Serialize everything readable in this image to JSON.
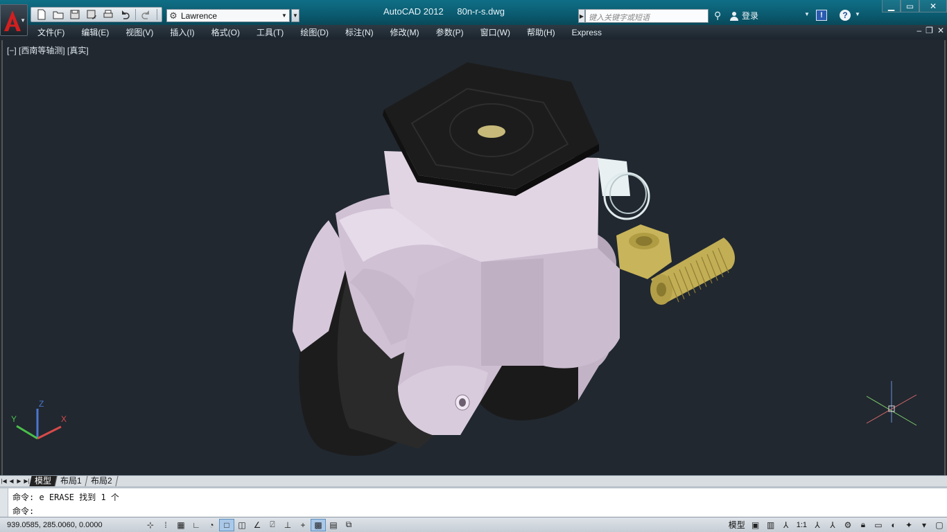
{
  "title": {
    "app": "AutoCAD 2012",
    "file": "80n-r-s.dwg"
  },
  "qat": {
    "workspace": "Lawrence"
  },
  "search": {
    "placeholder": "键入关键字或短语"
  },
  "user": {
    "login_label": "登录"
  },
  "menu": [
    "文件(F)",
    "编辑(E)",
    "视图(V)",
    "插入(I)",
    "格式(O)",
    "工具(T)",
    "绘图(D)",
    "标注(N)",
    "修改(M)",
    "参数(P)",
    "窗口(W)",
    "帮助(H)",
    "Express"
  ],
  "viewport": {
    "label": "[−] [西南等轴测] [真实]",
    "ucs": {
      "x": "X",
      "y": "Y",
      "z": "Z"
    }
  },
  "tabs": {
    "model": "模型",
    "layout1": "布局1",
    "layout2": "布局2"
  },
  "command": {
    "history": "命令: e ERASE 找到 1 个",
    "prompt": "命令:"
  },
  "status": {
    "coords": "939.0585, 285.0060, 0.0000",
    "model_label": "模型",
    "annotation_scale": "1:1"
  },
  "colors": {
    "viewport_bg": "#212830",
    "titlebar": "#0b5a6f",
    "body_part": "#d9c9dc",
    "wheel": "#1e1e1e",
    "brass": "#c8b45a"
  },
  "icons": [
    "autocad-logo-icon",
    "new-icon",
    "open-icon",
    "save-icon",
    "saveas-icon",
    "print-icon",
    "undo-icon",
    "redo-icon",
    "gear-icon",
    "search-icon",
    "binoculars-icon",
    "user-icon",
    "exchange-icon",
    "help-icon"
  ]
}
